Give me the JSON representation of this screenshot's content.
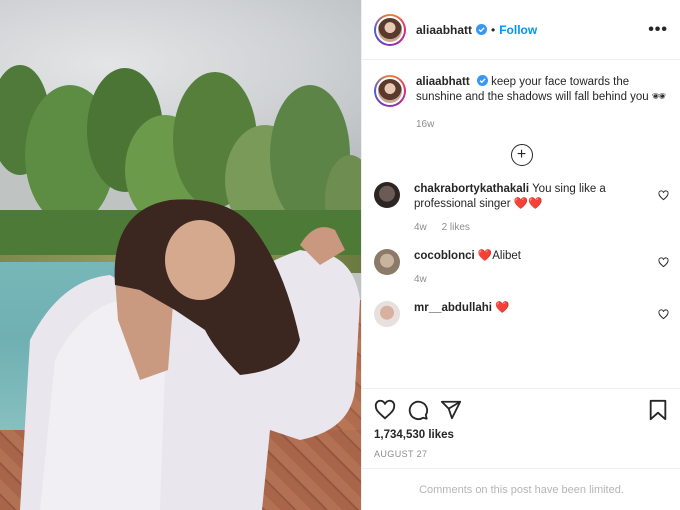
{
  "header": {
    "username": "aliaabhatt",
    "separator": "•",
    "follow_label": "Follow",
    "more_label": "•••"
  },
  "caption": {
    "username": "aliaabhatt",
    "text": "keep your face towards the sunshine and the shadows will fall behind you 🕶",
    "time": "16w"
  },
  "load_more": "+",
  "comments": [
    {
      "username": "chakrabortykathakali",
      "text": "You sing like a professional singer ❤️❤️",
      "time": "4w",
      "likes": "2 likes"
    },
    {
      "username": "cocoblonci",
      "text": "❤️Alibet",
      "time": "4w"
    },
    {
      "username": "mr__abdullahi",
      "text": "❤️",
      "time": ""
    }
  ],
  "actions": {
    "icons": [
      "heart-icon",
      "comment-icon",
      "share-icon",
      "bookmark-icon"
    ],
    "likes": "1,734,530 likes",
    "date": "AUGUST 27"
  },
  "footer": {
    "limited_text": "Comments on this post have been limited."
  },
  "colors": {
    "link": "#0095f6",
    "secondary": "#8e8e8e",
    "heart": "#ed4956",
    "verified": "#3897f0"
  }
}
